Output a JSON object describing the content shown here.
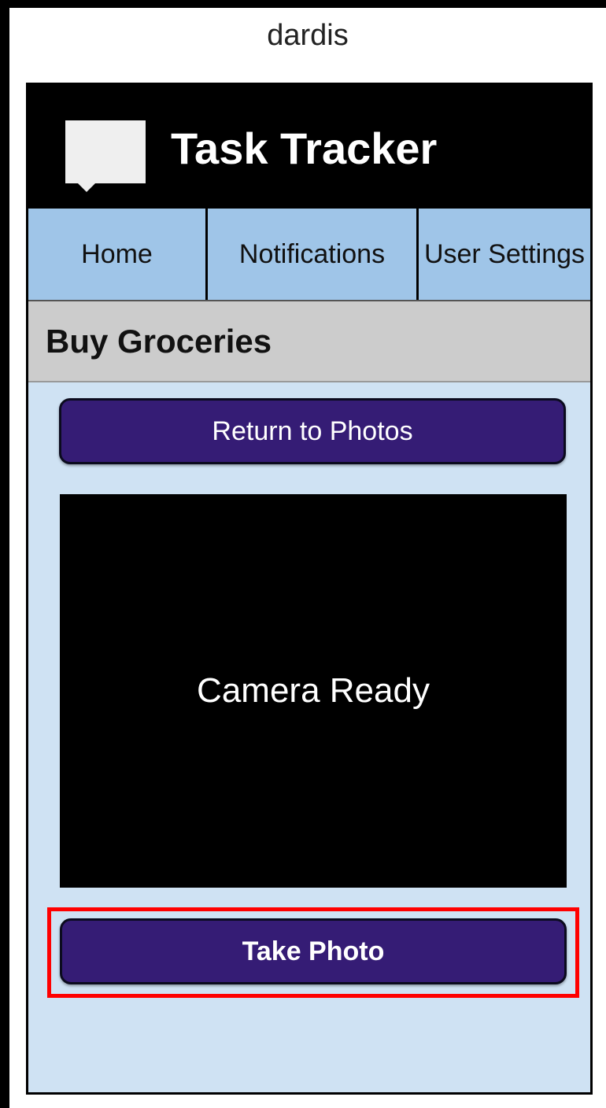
{
  "caption": "dardis",
  "app": {
    "title": "Task Tracker",
    "logo_icon": "speech-bubble-icon"
  },
  "nav": {
    "tabs": [
      {
        "label": "Home"
      },
      {
        "label": "Notifications"
      },
      {
        "label": "User Settings"
      }
    ]
  },
  "section": {
    "title": "Buy Groceries"
  },
  "actions": {
    "return_label": "Return to Photos",
    "take_photo_label": "Take Photo"
  },
  "camera": {
    "status": "Camera Ready"
  },
  "colors": {
    "header_bg": "#000000",
    "nav_bg": "#9fc5e8",
    "content_bg": "#cfe2f3",
    "section_bg": "#cccccc",
    "button_bg": "#351c75",
    "highlight": "#ff0000"
  }
}
